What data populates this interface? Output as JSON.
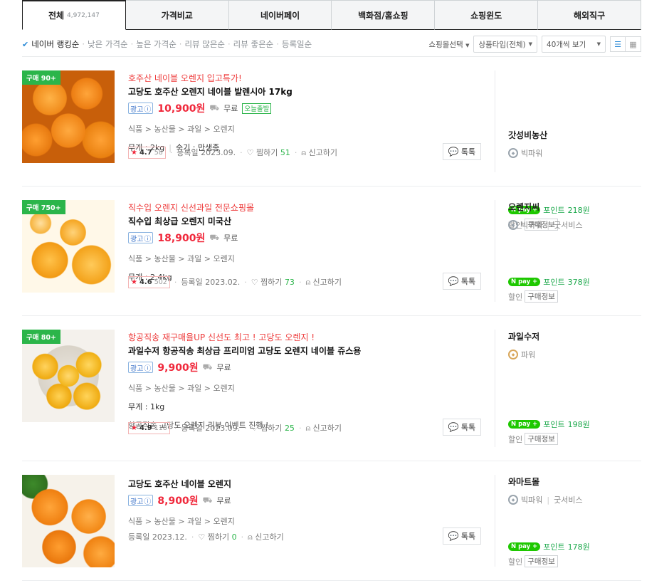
{
  "tabs": [
    {
      "label": "전체",
      "count": "4,972,147",
      "active": true
    },
    {
      "label": "가격비교"
    },
    {
      "label": "네이버페이"
    },
    {
      "label": "백화점/홈쇼핑"
    },
    {
      "label": "쇼핑윈도"
    },
    {
      "label": "해외직구"
    }
  ],
  "sort": {
    "options": [
      "네이버 랭킹순",
      "낮은 가격순",
      "높은 가격순",
      "리뷰 많은순",
      "리뷰 좋은순",
      "등록일순"
    ],
    "active_index": 0
  },
  "filters": {
    "mall_select": "쇼핑몰선택",
    "product_type": "상품타입(전체)",
    "page_size": "40개씩 보기"
  },
  "labels": {
    "ad": "광고",
    "free_ship": "무료",
    "today_ship": "오늘출발",
    "registered": "등록일",
    "jjim": "찜하기",
    "report": "신고하기",
    "talk": "톡톡",
    "discount": "할인",
    "purchase_info": "구매정보",
    "npay_logo": "pay",
    "point_prefix": "포인트"
  },
  "items": [
    {
      "badge": "구매 90+",
      "promo": "호주산 네이블 오렌지 입고특가!",
      "title": "고당도 호주산 오렌지 네이블 발렌시아 17kg",
      "price": "10,900원",
      "category": [
        "식품",
        "농산물",
        "과일",
        "오렌지"
      ],
      "spec": [
        "무게 : 2kg",
        "숙기 : 만생종"
      ],
      "rating": "4.7",
      "review_count": "58",
      "reg_date": "2023.09.",
      "jjim_count": "51",
      "mall": "갓성비농산",
      "grade": "빅파워",
      "services": [],
      "point": "218원"
    },
    {
      "badge": "구매 750+",
      "promo": "직수입 오렌지 신선과일 전문쇼핑몰",
      "title": "직수입 최상급 오렌지 미국산",
      "price": "18,900원",
      "category": [
        "식품",
        "농산물",
        "과일",
        "오렌지"
      ],
      "spec": [
        "무게 : 2.4kg"
      ],
      "rating": "4.6",
      "review_count": "502",
      "reg_date": "2023.02.",
      "jjim_count": "73",
      "mall": "오렌지씨",
      "grade": "빅파워",
      "services": [
        "굿서비스"
      ],
      "point": "378원"
    },
    {
      "badge": "구매 80+",
      "promo": "항공직송 재구매율UP 신선도 최고 ! 고당도 오렌지 !",
      "title": "과일수저 항공직송 최상급 프리미엄 고당도 오렌지 네이블 쥬스용",
      "price": "9,900원",
      "category": [
        "식품",
        "농산물",
        "과일",
        "오렌지"
      ],
      "spec": [
        "무게 : 1kg"
      ],
      "desc": "항공직송 고당도 오렌지 리뷰 이벤트 진행 !",
      "rating": "4.9",
      "review_count": "118",
      "reg_date": "2023.09.",
      "jjim_count": "25",
      "mall": "과일수저",
      "grade": "파워",
      "services": [],
      "point": "198원"
    },
    {
      "title": "고당도 호주산 네이블 오렌지",
      "price": "8,900원",
      "category": [
        "식품",
        "농산물",
        "과일",
        "오렌지"
      ],
      "reg_date": "2023.12.",
      "jjim_count": "0",
      "mall": "와마트몰",
      "grade": "빅파워",
      "services": [
        "굿서비스"
      ],
      "point": "178원"
    }
  ]
}
